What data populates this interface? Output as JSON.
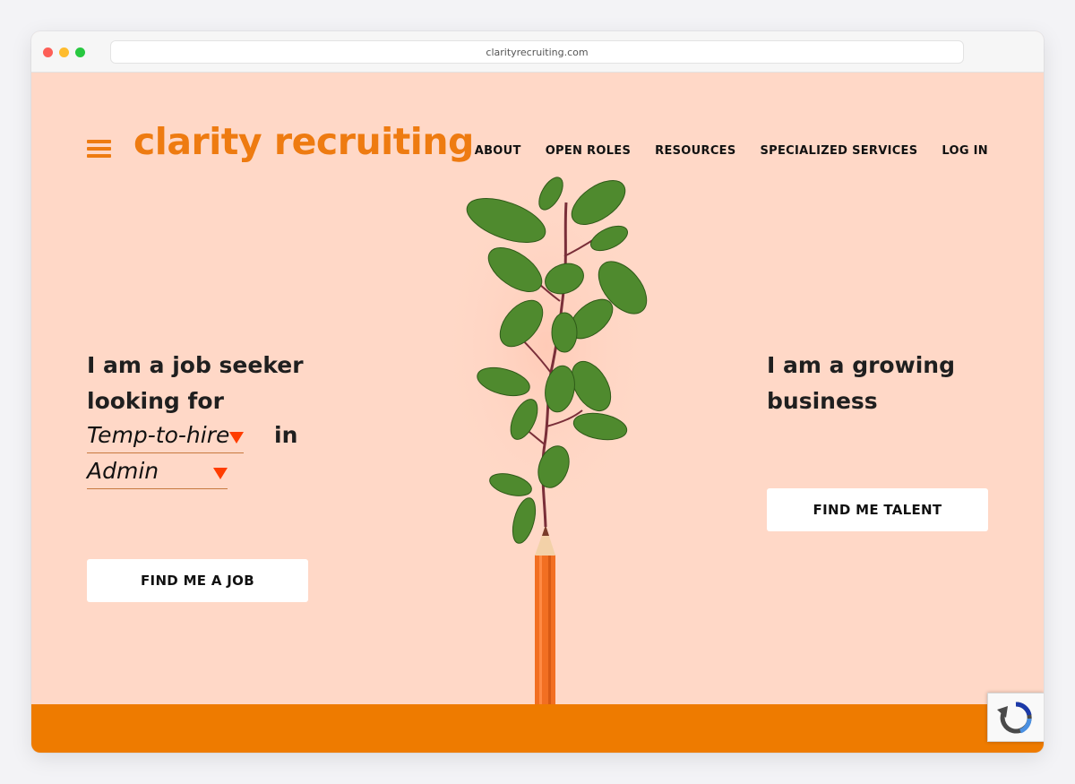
{
  "browser": {
    "url": "clarityrecruiting.com"
  },
  "header": {
    "logo": "clarity recruiting",
    "nav": [
      "ABOUT",
      "OPEN ROLES",
      "RESOURCES",
      "SPECIALIZED SERVICES",
      "LOG IN"
    ]
  },
  "seeker": {
    "line1": "I am a job seeker",
    "line2": "looking for",
    "job_type": "Temp-to-hire",
    "in_word": "in",
    "category": "Admin",
    "button": "FIND ME A JOB"
  },
  "business": {
    "line1": "I am a growing",
    "line2": "business",
    "button": "FIND ME TALENT"
  },
  "colors": {
    "brand_orange": "#ee7b11",
    "page_bg": "#ffd8c7",
    "caret_red": "#ff3d00"
  },
  "icons": {
    "menu": "hamburger-icon",
    "dropdown": "caret-down-icon",
    "recaptcha": "recaptcha-icon"
  }
}
